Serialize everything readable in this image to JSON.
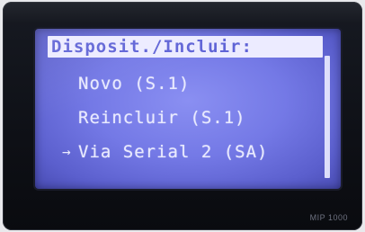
{
  "device": {
    "model": "MIP 1000"
  },
  "screen": {
    "title": "Disposit./Incluir:",
    "cursor_glyph": "→",
    "menu_items": [
      {
        "label": "Novo (S.1)",
        "selected": false
      },
      {
        "label": "Reincluir (S.1)",
        "selected": false
      },
      {
        "label": "Via Serial 2 (SA)",
        "selected": true
      }
    ],
    "colors": {
      "lcd_background": "#7479e6",
      "lcd_text": "#e9eafe",
      "title_background": "#ecebff"
    }
  }
}
